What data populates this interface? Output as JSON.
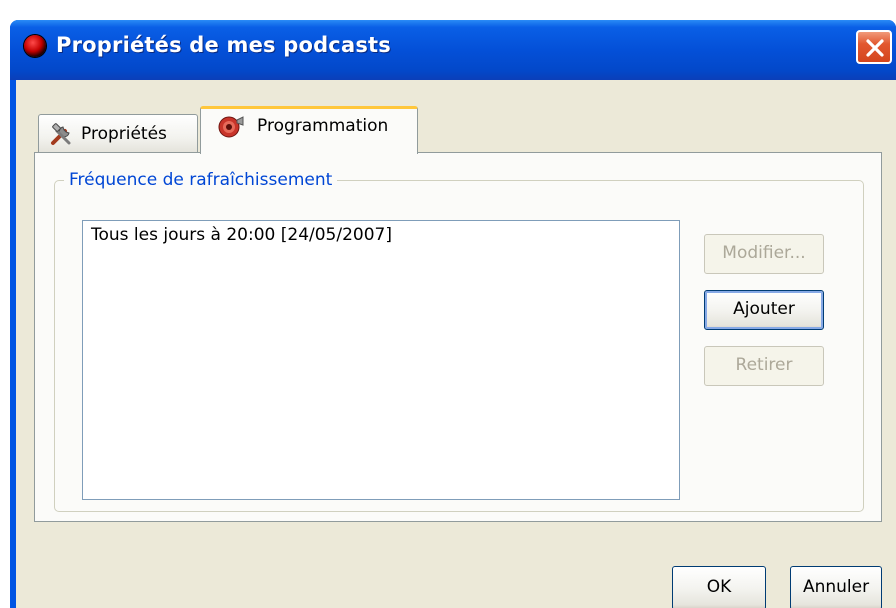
{
  "window": {
    "title": "Propriétés de mes podcasts",
    "accent": "#0054e3"
  },
  "tabs": [
    {
      "label": "Propriétés",
      "icon": "tools-icon",
      "active": false
    },
    {
      "label": "Programmation",
      "icon": "schedule-icon",
      "active": true
    }
  ],
  "group": {
    "legend": "Fréquence de rafraîchissement",
    "schedules": [
      "Tous les jours à 20:00 [24/05/2007]"
    ]
  },
  "actions": {
    "modify_label": "Modifier...",
    "add_label": "Ajouter",
    "remove_label": "Retirer"
  },
  "footer": {
    "ok_label": "OK",
    "cancel_label": "Annuler"
  }
}
